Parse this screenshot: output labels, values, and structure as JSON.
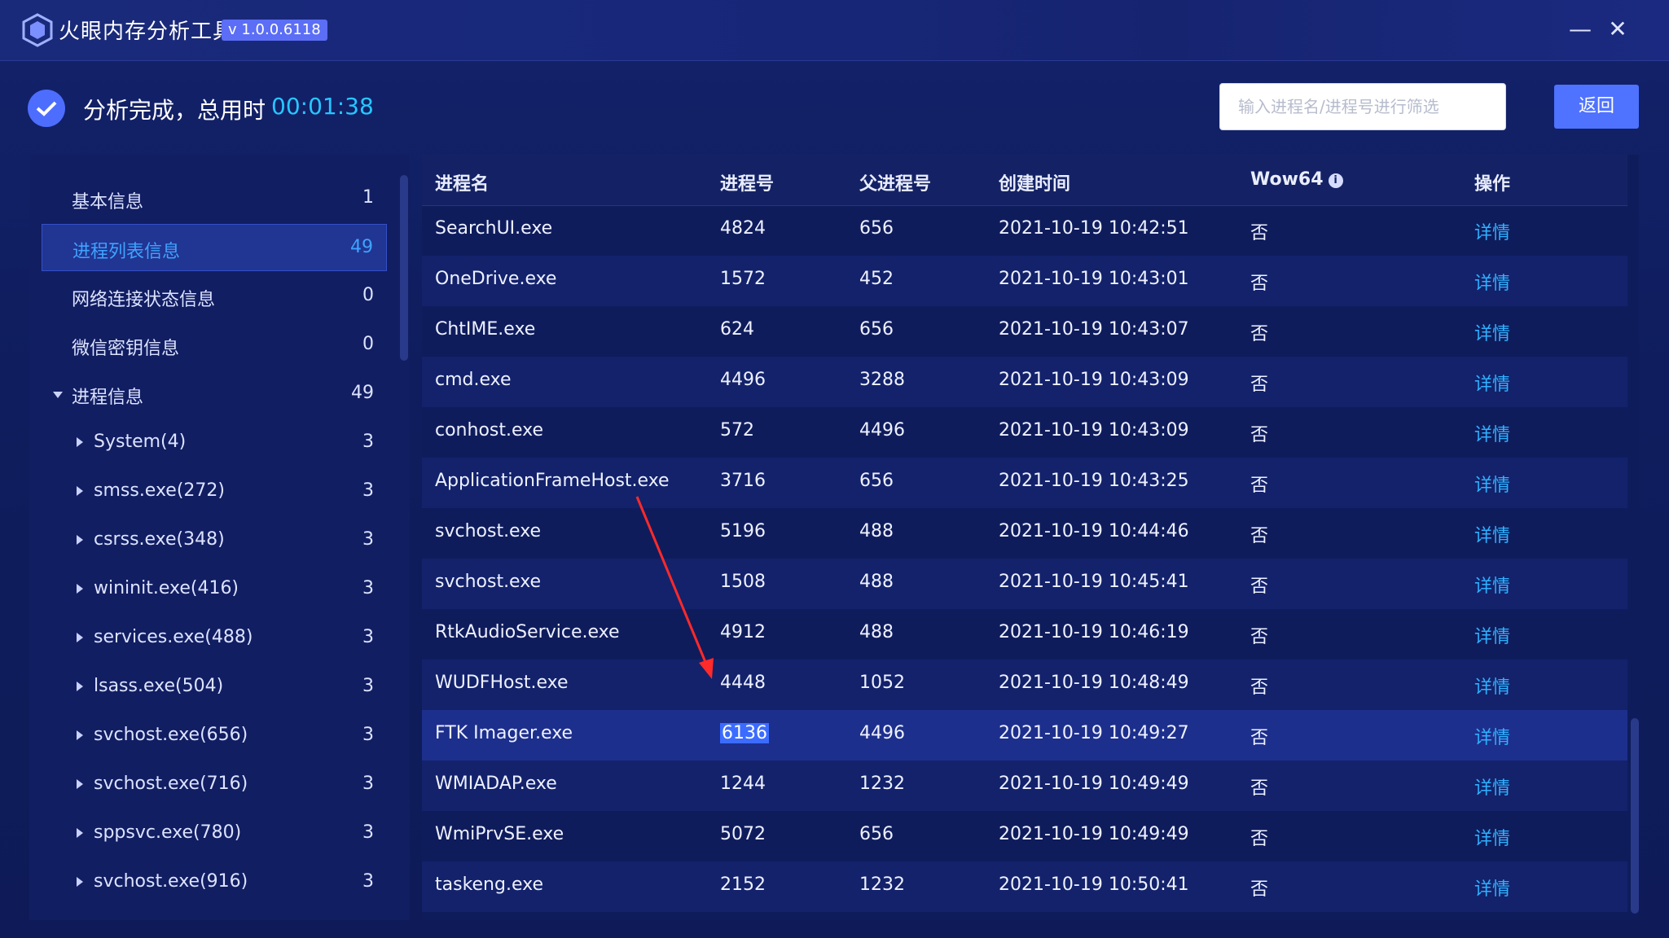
{
  "window": {
    "title": "火眼内存分析工具",
    "version": "v 1.0.0.6118",
    "minimize_glyph": "—",
    "close_glyph": "✕"
  },
  "header": {
    "status_text": "分析完成，总用时",
    "elapsed": "00:01:38",
    "search_placeholder": "输入进程名/进程号进行筛选",
    "back_label": "返回"
  },
  "sidebar": {
    "items": [
      {
        "label": "基本信息",
        "count": "1"
      },
      {
        "label": "进程列表信息",
        "count": "49"
      },
      {
        "label": "网络连接状态信息",
        "count": "0"
      },
      {
        "label": "微信密钥信息",
        "count": "0"
      },
      {
        "label": "进程信息",
        "count": "49"
      },
      {
        "label": "System(4)",
        "count": "3"
      },
      {
        "label": "smss.exe(272)",
        "count": "3"
      },
      {
        "label": "csrss.exe(348)",
        "count": "3"
      },
      {
        "label": "wininit.exe(416)",
        "count": "3"
      },
      {
        "label": "services.exe(488)",
        "count": "3"
      },
      {
        "label": "lsass.exe(504)",
        "count": "3"
      },
      {
        "label": "svchost.exe(656)",
        "count": "3"
      },
      {
        "label": "svchost.exe(716)",
        "count": "3"
      },
      {
        "label": "sppsvc.exe(780)",
        "count": "3"
      },
      {
        "label": "svchost.exe(916)",
        "count": "3"
      }
    ]
  },
  "table": {
    "headers": {
      "name": "进程名",
      "pid": "进程号",
      "ppid": "父进程号",
      "time": "创建时间",
      "wow": "Wow64",
      "op": "操作"
    },
    "rows": [
      {
        "name": "SearchUI.exe",
        "pid": "4824",
        "ppid": "656",
        "time": "2021-10-19 10:42:51",
        "wow": "否",
        "op": "详情"
      },
      {
        "name": "OneDrive.exe",
        "pid": "1572",
        "ppid": "452",
        "time": "2021-10-19 10:43:01",
        "wow": "否",
        "op": "详情"
      },
      {
        "name": "ChtIME.exe",
        "pid": "624",
        "ppid": "656",
        "time": "2021-10-19 10:43:07",
        "wow": "否",
        "op": "详情"
      },
      {
        "name": "cmd.exe",
        "pid": "4496",
        "ppid": "3288",
        "time": "2021-10-19 10:43:09",
        "wow": "否",
        "op": "详情"
      },
      {
        "name": "conhost.exe",
        "pid": "572",
        "ppid": "4496",
        "time": "2021-10-19 10:43:09",
        "wow": "否",
        "op": "详情"
      },
      {
        "name": "ApplicationFrameHost.exe",
        "pid": "3716",
        "ppid": "656",
        "time": "2021-10-19 10:43:25",
        "wow": "否",
        "op": "详情"
      },
      {
        "name": "svchost.exe",
        "pid": "5196",
        "ppid": "488",
        "time": "2021-10-19 10:44:46",
        "wow": "否",
        "op": "详情"
      },
      {
        "name": "svchost.exe",
        "pid": "1508",
        "ppid": "488",
        "time": "2021-10-19 10:45:41",
        "wow": "否",
        "op": "详情"
      },
      {
        "name": "RtkAudioService.exe",
        "pid": "4912",
        "ppid": "488",
        "time": "2021-10-19 10:46:19",
        "wow": "否",
        "op": "详情"
      },
      {
        "name": "WUDFHost.exe",
        "pid": "4448",
        "ppid": "1052",
        "time": "2021-10-19 10:48:49",
        "wow": "否",
        "op": "详情"
      },
      {
        "name": "FTK Imager.exe",
        "pid": "6136",
        "ppid": "4496",
        "time": "2021-10-19 10:49:27",
        "wow": "否",
        "op": "详情"
      },
      {
        "name": "WMIADAP.exe",
        "pid": "1244",
        "ppid": "1232",
        "time": "2021-10-19 10:49:49",
        "wow": "否",
        "op": "详情"
      },
      {
        "name": "WmiPrvSE.exe",
        "pid": "5072",
        "ppid": "656",
        "time": "2021-10-19 10:49:49",
        "wow": "否",
        "op": "详情"
      },
      {
        "name": "taskeng.exe",
        "pid": "2152",
        "ppid": "1232",
        "time": "2021-10-19 10:50:41",
        "wow": "否",
        "op": "详情"
      }
    ]
  },
  "colors": {
    "accent": "#4f72ff",
    "link": "#2fb1ff",
    "elapsed": "#27c6ff",
    "annotation_arrow": "#ff2a2a"
  }
}
